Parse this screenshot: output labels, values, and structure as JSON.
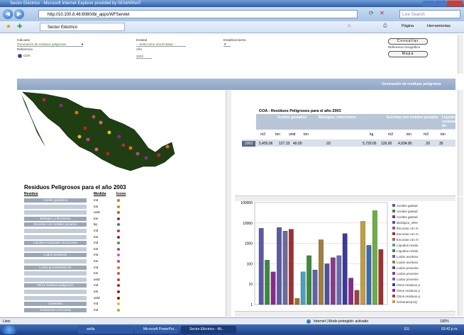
{
  "window": {
    "title": "Sector Eléctrico - Microsoft Internet Explorer provided by SEMARNAT"
  },
  "browser": {
    "url": "http://10.100.8.46:8080/ibi_apps/WFServlet",
    "search_placeholder": "Live Search",
    "tab_title": "Sector Eléctrico",
    "page_menu": "Página",
    "tools_menu": "Herramientas"
  },
  "form": {
    "indicador_label": "Indicador",
    "indicador_value": "Generación de residuos peligrosos",
    "entidad_label": "Entidad",
    "entidad_value": "-- Seleccione una Entidad --",
    "establecimiento_label": "Establecimiento",
    "referencia_label": "Referencia",
    "referencia_option": "COA",
    "anio_label": "Año",
    "anio_value": "2003",
    "consultar": "Consultar",
    "ref_geografica_label": "Referencia Geográfica",
    "mapa": "Mapa"
  },
  "header_band": "Generación de residuos peligrosos",
  "legend": {
    "title": "Residuos Peligrosos para el año 2003",
    "col_residuo": "Residuo",
    "col_medida": "Medida",
    "col_icono": "Icono",
    "rows": [
      {
        "name": "Aceites gastados",
        "unit": "m3",
        "color": "#e07020"
      },
      {
        "name": "",
        "unit": "ton",
        "color": "#d08020"
      },
      {
        "name": "",
        "unit": "unid",
        "color": "#c06010"
      },
      {
        "name": "Biológico_infecciosos",
        "unit": "ton",
        "color": "#8a2a8a"
      },
      {
        "name": "Escorias con metales pesados",
        "unit": "kg",
        "color": "#3a8a3a"
      },
      {
        "name": "",
        "unit": "m3",
        "color": "#c03060"
      },
      {
        "name": "",
        "unit": "ton",
        "color": "#a02040"
      },
      {
        "name": "Líquidos residuales de proceso",
        "unit": "m3",
        "color": "#40a040"
      },
      {
        "name": "",
        "unit": "ton",
        "color": "#c04080"
      },
      {
        "name": "Lodos aceitosos",
        "unit": "m3",
        "color": "#e06080"
      },
      {
        "name": "",
        "unit": "ton",
        "color": "#d04070"
      },
      {
        "name": "Lodos provenientes de",
        "unit": "m3",
        "color": "#e07040"
      },
      {
        "name": "",
        "unit": "ton",
        "color": "#c06030"
      },
      {
        "name": "",
        "unit": "unid",
        "color": "#b05020"
      },
      {
        "name": "Otros residuos peligrosos",
        "unit": "m3",
        "color": "#c02020"
      },
      {
        "name": "",
        "unit": "ton",
        "color": "#a01818"
      },
      {
        "name": "",
        "unit": "unid",
        "color": "#901010"
      },
      {
        "name": "Solventes",
        "unit": "m3",
        "color": "#e0c020"
      },
      {
        "name": "Sustancias corrosivas",
        "unit": "m3",
        "color": "#d0a020"
      }
    ]
  },
  "table": {
    "title": "COA - Residuos Peligrosos para el año 2003",
    "groups": [
      "Aceites gastados",
      "Biológico_infecciosos",
      "Escorias con metales pesados",
      "Líquidos residuales de proceso"
    ],
    "units": [
      "m3",
      "ton",
      "unid",
      "ton",
      "kg",
      "m3",
      "ton",
      "m3",
      "ton"
    ],
    "year": "2003",
    "values": [
      "5,455.06",
      "127.15",
      "40.00",
      ".03",
      "5,720.00",
      "126.00",
      "4,934.90",
      ".20",
      "35"
    ]
  },
  "chart_data": {
    "type": "bar",
    "ylim": [
      1,
      100000
    ],
    "yscale": "log",
    "yticks": [
      "100000",
      "10000",
      "1000",
      "100",
      "10",
      "1"
    ],
    "values": [
      5455,
      150,
      40,
      6000,
      4000,
      4935,
      2,
      40,
      250,
      50,
      1500,
      100,
      200,
      250,
      3000,
      20,
      5,
      12000,
      800,
      40000,
      500
    ],
    "colors": [
      "#5a5aa8",
      "#3a8a3a",
      "#8a2a8a",
      "#5a5aa8",
      "#6a6a9a",
      "#a03030",
      "#a07030",
      "#4aa0c0",
      "#3a8a3a",
      "#6060b0",
      "#a08040",
      "#5050a0",
      "#8a3a8a",
      "#6a6ab0",
      "#3a3aa0",
      "#8a2a8a",
      "#a04040",
      "#c0a040",
      "#3a6ab0",
      "#6ab040",
      "#a03030"
    ],
    "legend": [
      "Aceites gastad",
      "Aceites gastad",
      "Aceites gastad",
      "Biológico_infec",
      "Escorias con m",
      "Escorias con m",
      "Escorias con m",
      "Líquidos residu",
      "Líquidos residu",
      "Lodos aceitoso",
      "Lodos aceitoso",
      "Lodos provenie",
      "Lodos provenie",
      "Lodos provenie",
      "Otros residuos p",
      "Otros residuos p",
      "Otros residuos p",
      "Solventes(m3)"
    ],
    "legend_colors": [
      "#5a5aa8",
      "#3a8a3a",
      "#8a2a8a",
      "#5a5aa8",
      "#6a6a9a",
      "#a03030",
      "#a07030",
      "#4aa0c0",
      "#3a8a3a",
      "#6060b0",
      "#a08040",
      "#5050a0",
      "#8a3a8a",
      "#6a6ab0",
      "#3a3aa0",
      "#8a2a8a",
      "#a04040",
      "#c0a040"
    ]
  },
  "status": {
    "left": "Listo",
    "zone": "Internet | Modo protegido: activado",
    "zoom": "100%"
  },
  "taskbar": {
    "item1": "avilla",
    "item2": "Microsoft PowerPoi...",
    "item3": "Sector Eléctrico - Mi...",
    "lang": "ES",
    "clock": "03:42 p.m."
  }
}
